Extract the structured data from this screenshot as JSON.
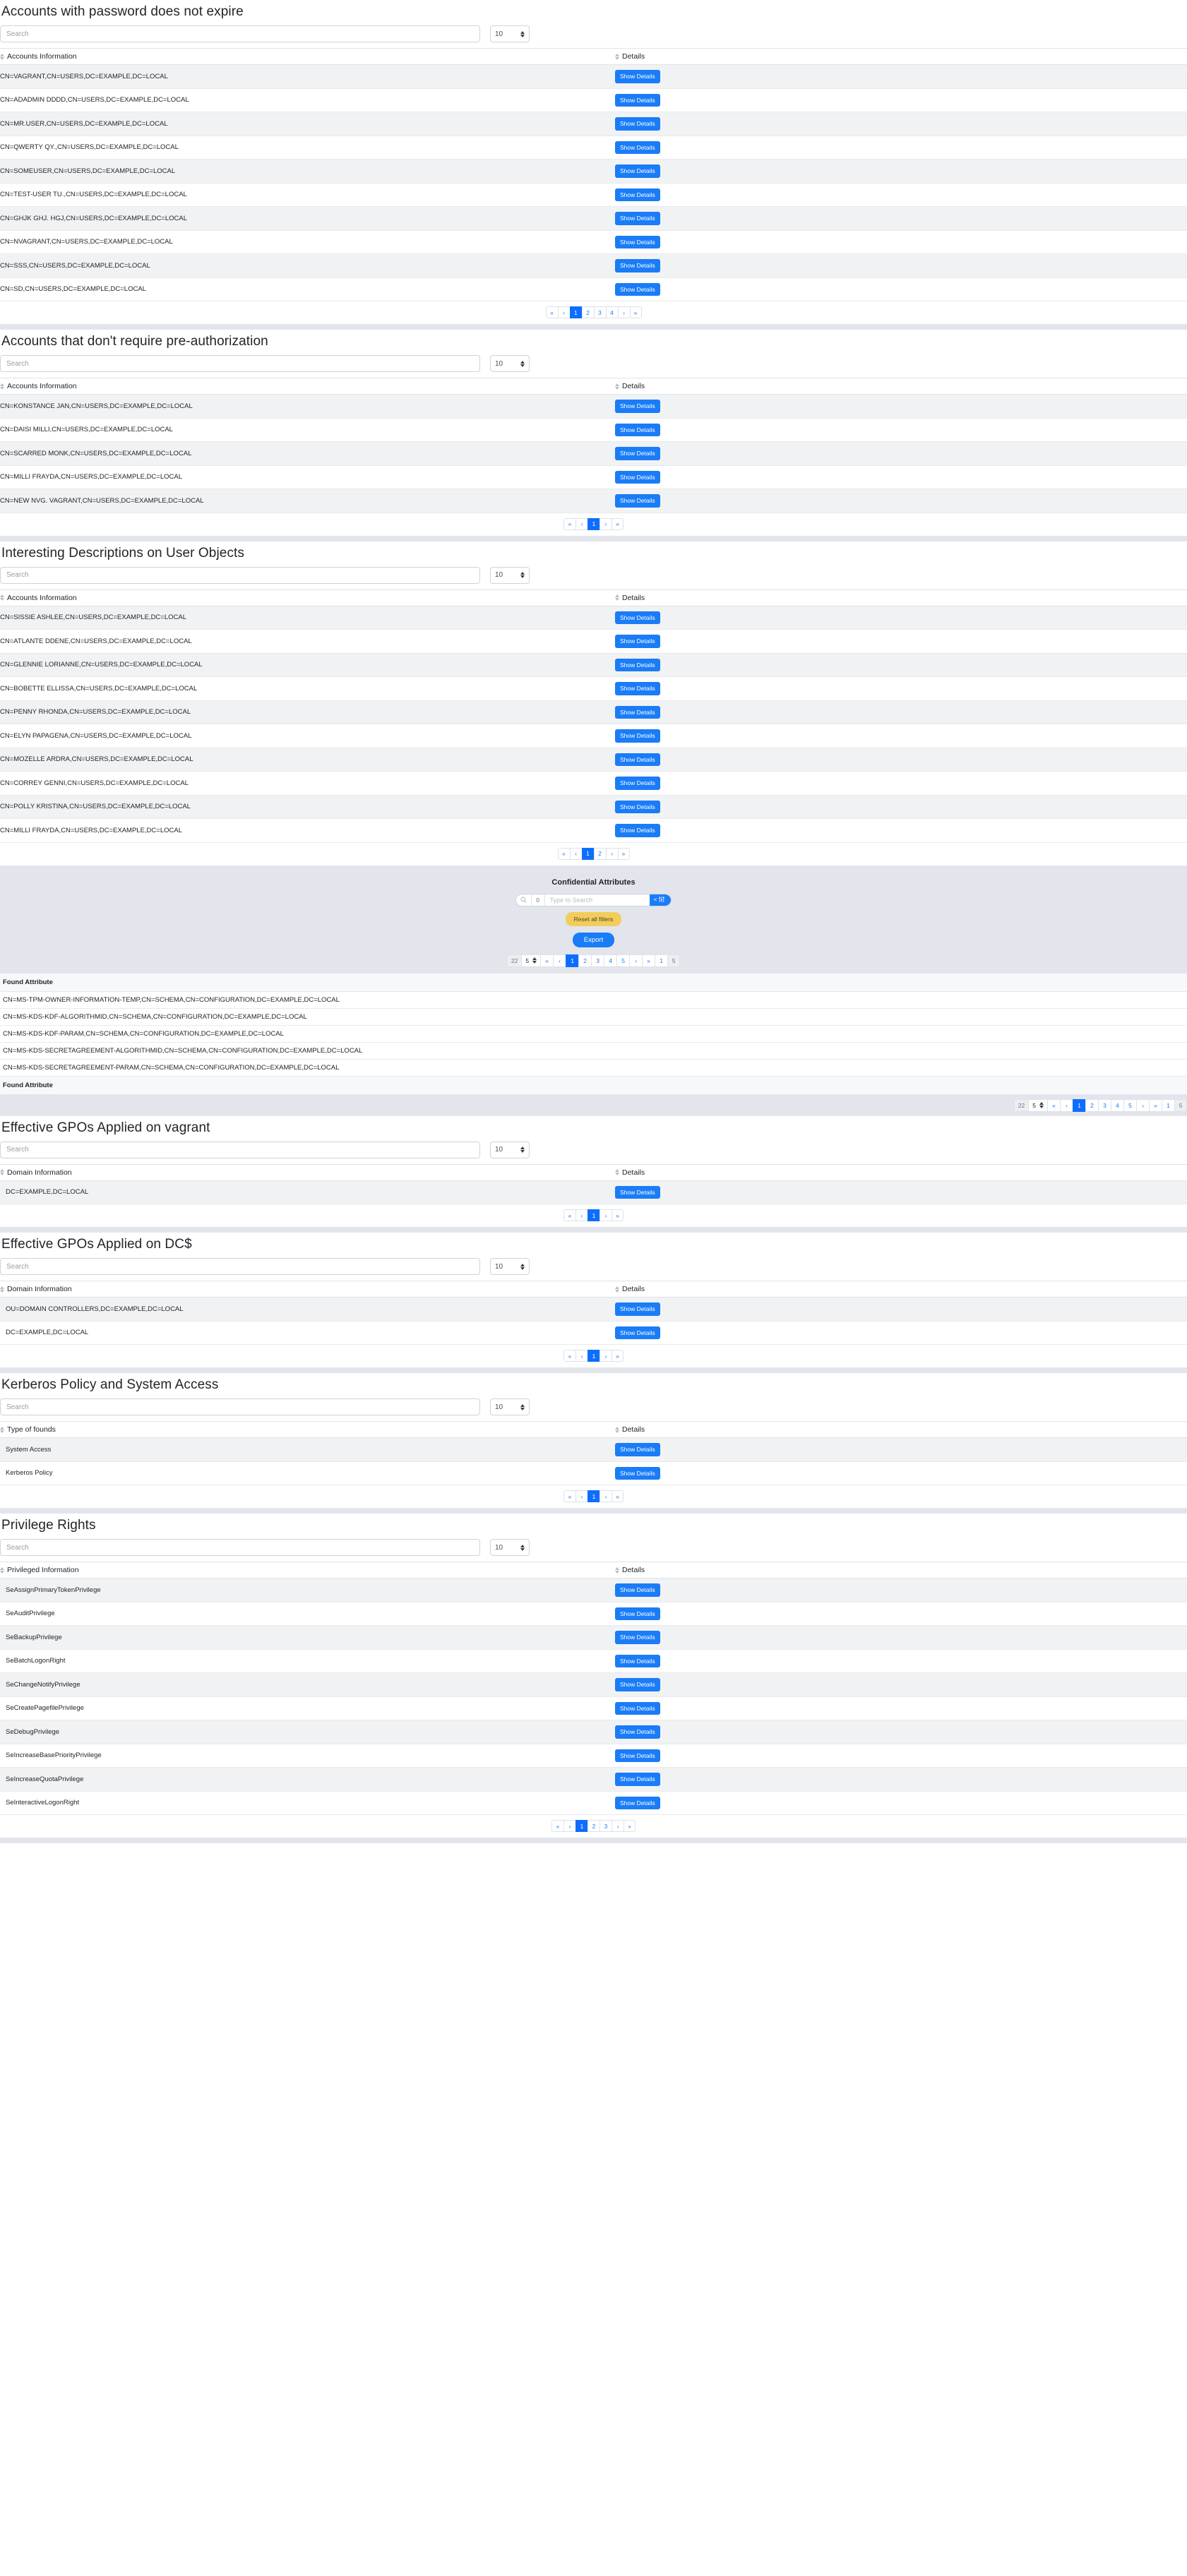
{
  "common": {
    "search_placeholder": "Search",
    "page_size_value": "10",
    "show_details_label": "Show Details",
    "col_details": "Details",
    "col_accounts_information": "Accounts Information",
    "col_domain_information": "Domain Information",
    "col_type_of_founds": "Type of founds",
    "col_privileged_information": "Privileged Information",
    "pg_first": "«",
    "pg_prev": "‹",
    "pg_next": "›",
    "pg_last": "»"
  },
  "sections": [
    {
      "id": "accounts-password-never-expires",
      "title": "Accounts with password does not expire",
      "column": "Accounts Information",
      "rows": [
        "CN=VAGRANT,CN=USERS,DC=EXAMPLE,DC=LOCAL",
        "CN=ADADMIN DDDD,CN=USERS,DC=EXAMPLE,DC=LOCAL",
        "CN=MR.USER,CN=USERS,DC=EXAMPLE,DC=LOCAL",
        "CN=QWERTY QY.,CN=USERS,DC=EXAMPLE,DC=LOCAL",
        "CN=SOMEUSER,CN=USERS,DC=EXAMPLE,DC=LOCAL",
        "CN=TEST-USER TU.,CN=USERS,DC=EXAMPLE,DC=LOCAL",
        "CN=GHJK GHJ. HGJ,CN=USERS,DC=EXAMPLE,DC=LOCAL",
        "CN=NVAGRANT,CN=USERS,DC=EXAMPLE,DC=LOCAL",
        "CN=SSS,CN=USERS,DC=EXAMPLE,DC=LOCAL",
        "CN=SD,CN=USERS,DC=EXAMPLE,DC=LOCAL"
      ],
      "pages": [
        "1",
        "2",
        "3",
        "4"
      ],
      "active_page": "1"
    },
    {
      "id": "accounts-no-preauth",
      "title": "Accounts that don't require pre-authorization",
      "column": "Accounts Information",
      "rows": [
        "CN=KONSTANCE JAN,CN=USERS,DC=EXAMPLE,DC=LOCAL",
        "CN=DAISI MILLI,CN=USERS,DC=EXAMPLE,DC=LOCAL",
        "CN=SCARRED MONK,CN=USERS,DC=EXAMPLE,DC=LOCAL",
        "CN=MILLI FRAYDA,CN=USERS,DC=EXAMPLE,DC=LOCAL",
        "CN=NEW NVG. VAGRANT,CN=USERS,DC=EXAMPLE,DC=LOCAL"
      ],
      "pages": [
        "1"
      ],
      "active_page": "1"
    },
    {
      "id": "interesting-descriptions",
      "title": "Interesting Descriptions on User Objects",
      "column": "Accounts Information",
      "rows": [
        "CN=SISSIE ASHLEE,CN=USERS,DC=EXAMPLE,DC=LOCAL",
        "CN=ATLANTE DDENE,CN=USERS,DC=EXAMPLE,DC=LOCAL",
        "CN=GLENNIE LORIANNE,CN=USERS,DC=EXAMPLE,DC=LOCAL",
        "CN=BOBETTE ELLISSA,CN=USERS,DC=EXAMPLE,DC=LOCAL",
        "CN=PENNY RHONDA,CN=USERS,DC=EXAMPLE,DC=LOCAL",
        "CN=ELYN PAPAGENA,CN=USERS,DC=EXAMPLE,DC=LOCAL",
        "CN=MOZELLE ARDRA,CN=USERS,DC=EXAMPLE,DC=LOCAL",
        "CN=CORREY GENNI,CN=USERS,DC=EXAMPLE,DC=LOCAL",
        "CN=POLLY KRISTINA,CN=USERS,DC=EXAMPLE,DC=LOCAL",
        "CN=MILLI FRAYDA,CN=USERS,DC=EXAMPLE,DC=LOCAL"
      ],
      "pages": [
        "1",
        "2"
      ],
      "active_page": "1"
    }
  ],
  "confidential": {
    "title": "Confidential Attributes",
    "search_count": "0",
    "search_placeholder": "Type to Search",
    "toggle_label": "<",
    "reset_label": "Reset all filters",
    "export_label": "Export",
    "total": "22",
    "per_page": "5",
    "pages": [
      "1",
      "2",
      "3",
      "4",
      "5"
    ],
    "active_page": "1",
    "current_page_box": "1",
    "total_pages_box": "5",
    "column_header": "Found Attribute",
    "column_footer": "Found Attribute",
    "rows": [
      "CN=MS-TPM-OWNER-INFORMATION-TEMP,CN=SCHEMA,CN=CONFIGURATION,DC=EXAMPLE,DC=LOCAL",
      "CN=MS-KDS-KDF-ALGORITHMID,CN=SCHEMA,CN=CONFIGURATION,DC=EXAMPLE,DC=LOCAL",
      "CN=MS-KDS-KDF-PARAM,CN=SCHEMA,CN=CONFIGURATION,DC=EXAMPLE,DC=LOCAL",
      "CN=MS-KDS-SECRETAGREEMENT-ALGORITHMID,CN=SCHEMA,CN=CONFIGURATION,DC=EXAMPLE,DC=LOCAL",
      "CN=MS-KDS-SECRETAGREEMENT-PARAM,CN=SCHEMA,CN=CONFIGURATION,DC=EXAMPLE,DC=LOCAL"
    ]
  },
  "sections2": [
    {
      "id": "gpos-vagrant",
      "title": "Effective GPOs Applied on vagrant",
      "column": "Domain Information",
      "rows": [
        "DC=EXAMPLE,DC=LOCAL"
      ],
      "pages": [
        "1"
      ],
      "active_page": "1",
      "indent": true
    },
    {
      "id": "gpos-dc",
      "title": "Effective GPOs Applied on DC$",
      "column": "Domain Information",
      "rows": [
        "OU=DOMAIN CONTROLLERS,DC=EXAMPLE,DC=LOCAL",
        "DC=EXAMPLE,DC=LOCAL"
      ],
      "pages": [
        "1"
      ],
      "active_page": "1",
      "indent": true
    },
    {
      "id": "kerberos-policy",
      "title": "Kerberos Policy and System Access",
      "column": "Type of founds",
      "rows": [
        "System Access",
        "Kerberos Policy"
      ],
      "pages": [
        "1"
      ],
      "active_page": "1",
      "indent": true
    },
    {
      "id": "privilege-rights",
      "title": "Privilege Rights",
      "column": "Privileged Information",
      "rows": [
        "SeAssignPrimaryTokenPrivilege",
        "SeAuditPrivilege",
        "SeBackupPrivilege",
        "SeBatchLogonRight",
        "SeChangeNotifyPrivilege",
        "SeCreatePagefilePrivilege",
        "SeDebugPrivilege",
        "SeIncreaseBasePriorityPrivilege",
        "SeIncreaseQuotaPrivilege",
        "SeInteractiveLogonRight"
      ],
      "pages": [
        "1",
        "2",
        "3"
      ],
      "active_page": "1",
      "indent": true
    }
  ],
  "colors": {
    "primary": "#1a7cf7",
    "pager_active": "#0d6efd",
    "band": "#e2e5ec",
    "row_alt": "#f1f2f3",
    "warning": "#f3cd5b"
  }
}
